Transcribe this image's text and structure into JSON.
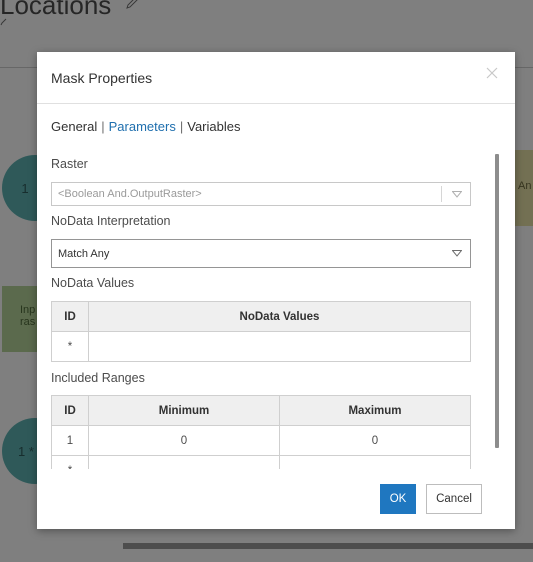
{
  "background": {
    "page_title": "Locations",
    "circle_1_text": "1",
    "circle_2_text": "1 *",
    "green_node_text": "Inp ras",
    "yellow_node_text": "An"
  },
  "dialog": {
    "title": "Mask Properties",
    "tabs": [
      {
        "label": "General",
        "active": false
      },
      {
        "label": "Parameters",
        "active": true
      },
      {
        "label": "Variables",
        "active": false
      }
    ],
    "tab_separator": "|",
    "raster": {
      "label": "Raster",
      "value": "<Boolean And.OutputRaster>",
      "disabled": true
    },
    "nodata_interpretation": {
      "label": "NoData Interpretation",
      "value": "Match Any"
    },
    "nodata_values": {
      "label": "NoData Values",
      "columns": [
        "ID",
        "NoData Values"
      ],
      "rows": [
        [
          "*",
          ""
        ]
      ]
    },
    "included_ranges": {
      "label": "Included Ranges",
      "columns": [
        "ID",
        "Minimum",
        "Maximum"
      ],
      "rows": [
        [
          "1",
          "0",
          "0"
        ],
        [
          "*",
          "",
          ""
        ]
      ]
    },
    "ok_label": "OK",
    "cancel_label": "Cancel"
  },
  "colors": {
    "accent": "#1f77c0",
    "active_tab": "#1f6fae",
    "overlay": "#000000"
  }
}
